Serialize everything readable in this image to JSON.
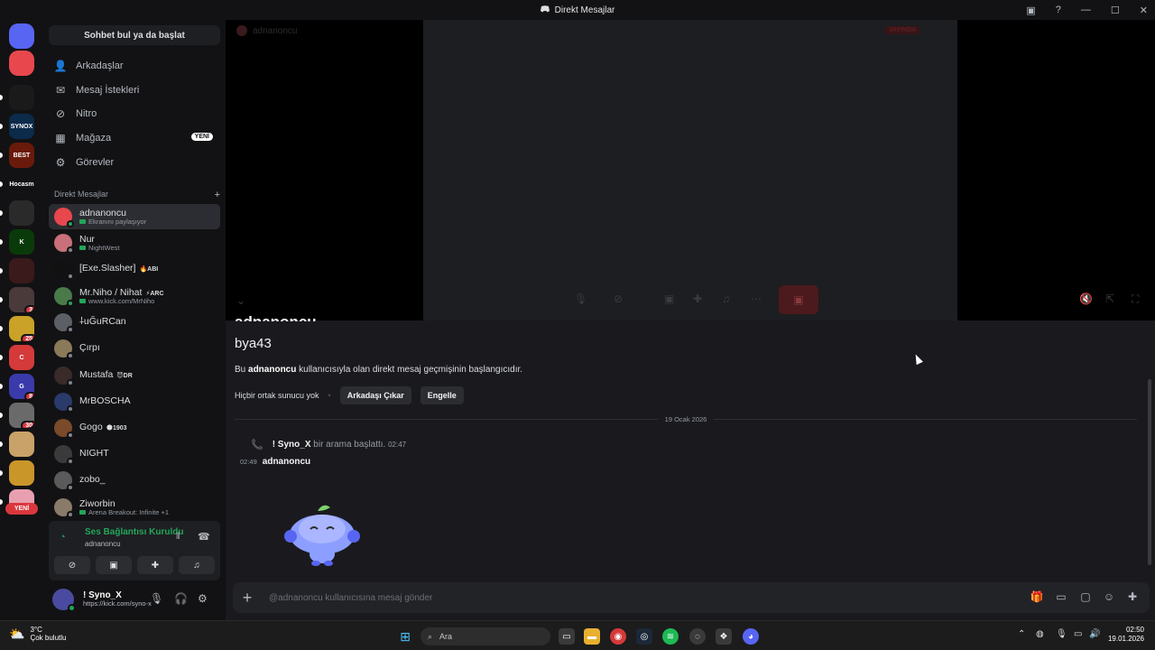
{
  "window": {
    "title": "Direkt Mesajlar"
  },
  "sidebar": {
    "search_label": "Sohbet bul ya da başlat",
    "nav": [
      {
        "label": "Arkadaşlar",
        "icon": "friends-icon"
      },
      {
        "label": "Mesaj İstekleri",
        "icon": "mail-icon"
      },
      {
        "label": "Nitro",
        "icon": "nitro-icon"
      },
      {
        "label": "Mağaza",
        "icon": "shop-icon",
        "badge": "YENİ"
      },
      {
        "label": "Görevler",
        "icon": "quests-icon"
      }
    ],
    "dm_header": "Direkt Mesajlar",
    "dms": [
      {
        "name": "adnanoncu",
        "sub": "Ekranını paylaşıyor",
        "online": true,
        "active": true,
        "color": "#e8474e"
      },
      {
        "name": "Nur",
        "sub": "NightWest",
        "online": false,
        "color": "#c9707a"
      },
      {
        "name": "[Exe.Slasher]",
        "tag": "🔥ABI",
        "online": false,
        "color": "#111111"
      },
      {
        "name": "Mr.Niho / Nihat",
        "tag": "⚡ARC",
        "sub": "www.kick.com/MrNiho",
        "online": true,
        "color": "#4a7a4a"
      },
      {
        "name": "⸸uĞuRCan",
        "online": false,
        "color": "#5c5f66"
      },
      {
        "name": "Çırpı",
        "online": false,
        "color": "#8a7a5a"
      },
      {
        "name": "Mustafa",
        "tag": "😈DR",
        "online": false,
        "color": "#3a2a2a"
      },
      {
        "name": "MrBOSCHA",
        "online": false,
        "color": "#2a3a6a"
      },
      {
        "name": "Gogo",
        "tag": "🌑1903",
        "online": false,
        "color": "#7a4a2a"
      },
      {
        "name": "NIGHT",
        "online": false,
        "color": "#3a3a3a"
      },
      {
        "name": "zobo_",
        "online": false,
        "color": "#5a5a5a"
      },
      {
        "name": "Ziworbin",
        "sub": "Arena Breakout: Infinite +1",
        "online": false,
        "color": "#8a7a6a"
      }
    ],
    "add_dm_icon": "plus-icon"
  },
  "servers": [
    {
      "label": "",
      "color": "#5865f2",
      "icon": "discord-home-icon"
    },
    {
      "label": "",
      "color": "#e8474e",
      "icon": "discord-dm-icon"
    },
    {
      "label": "",
      "color": "#1a1a1a"
    },
    {
      "label": "SYNOX",
      "color": "#0c2a4a"
    },
    {
      "label": "BEST",
      "color": "#6a1a0a"
    },
    {
      "label": "Hocasm",
      "color": "#121214"
    },
    {
      "label": "",
      "color": "#2a2a2a"
    },
    {
      "label": "K",
      "color": "#0a3a0a"
    },
    {
      "label": "",
      "color": "#3a1a1a"
    },
    {
      "label": "",
      "color": "#4a3a3a",
      "badge": "3"
    },
    {
      "label": "",
      "color": "#c9a227",
      "badge": "25"
    },
    {
      "label": "C",
      "color": "#d43a3a"
    },
    {
      "label": "G",
      "color": "#3a3aaa",
      "badge": "8"
    },
    {
      "label": "",
      "color": "#6a6a6a",
      "badge": "30"
    },
    {
      "label": "",
      "color": "#c9a26a"
    },
    {
      "label": "",
      "color": "#c9962a"
    },
    {
      "label": "",
      "color": "#e8a0b0"
    }
  ],
  "servers_new_label": "YENİ",
  "voice": {
    "status": "Ses Bağlantısı Kuruldu",
    "channel": "adnanoncu"
  },
  "user": {
    "name": "! Syno_X",
    "status": "https://kick.com/syno-x"
  },
  "stream": {
    "name": "adnanoncu",
    "live_label": "YAYINDA",
    "cut_heading": "adnanoncu"
  },
  "chat": {
    "username": "bya43",
    "intro_prefix": "Bu ",
    "intro_name": "adnanoncu",
    "intro_suffix": " kullanıcısıyla olan direkt mesaj geçmişinin başlangıcıdır.",
    "no_mutual": "Hiçbir ortak sunucu yok",
    "remove_friend": "Arkadaşı Çıkar",
    "block": "Engelle",
    "date": "19 Ocak 2026",
    "call_user": "! Syno_X",
    "call_text": "bir arama başlattı.",
    "call_time": "02:47",
    "msg_time": "02:49",
    "msg_author": "adnanoncu",
    "composer_placeholder": "@adnanoncu kullanıcısına mesaj gönder"
  },
  "taskbar": {
    "temp": "3°C",
    "weather": "Çok bulutlu",
    "search_placeholder": "Ara",
    "time": "02:50",
    "date": "19.01.2026"
  }
}
